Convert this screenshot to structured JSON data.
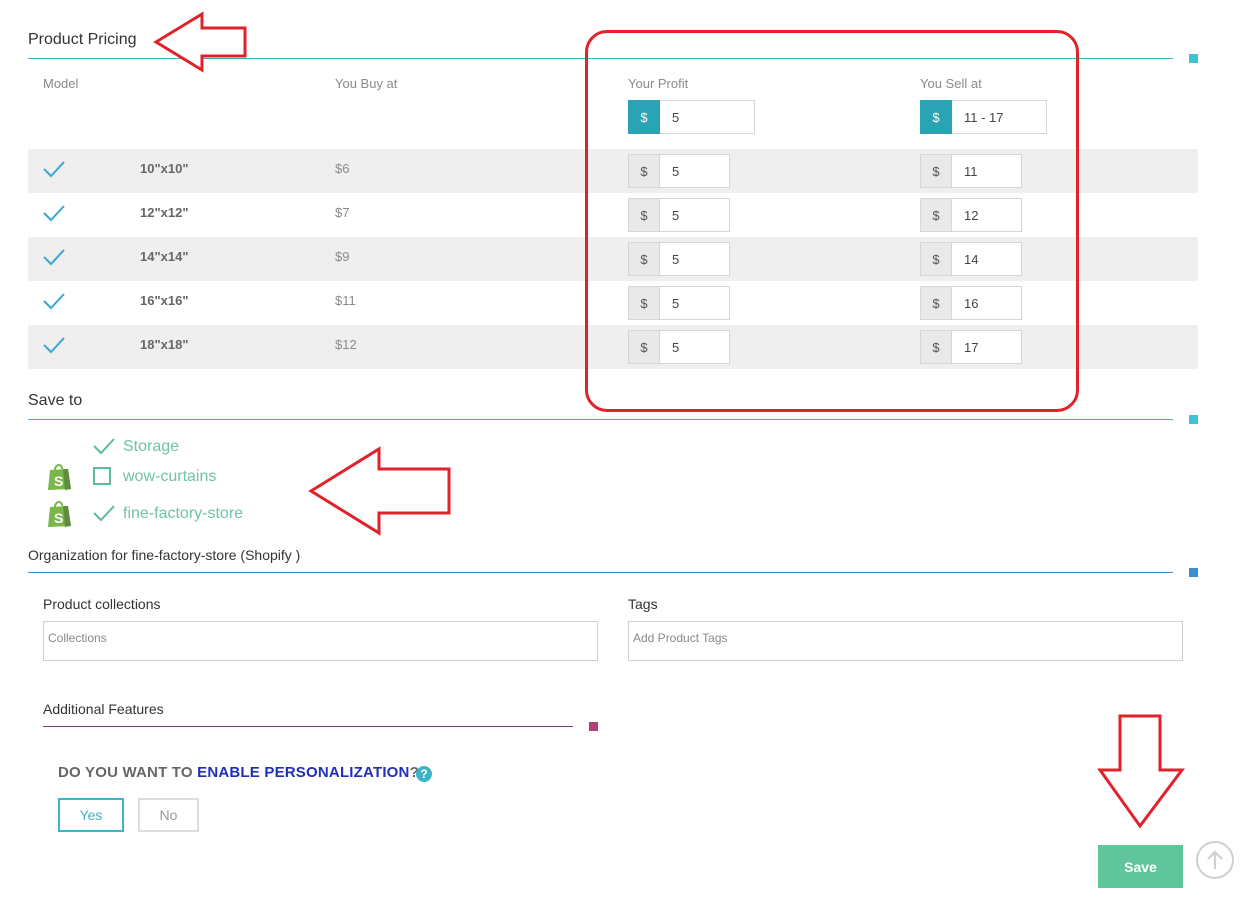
{
  "pricing": {
    "title": "Product Pricing",
    "headers": {
      "model": "Model",
      "buy": "You Buy at",
      "profit": "Your Profit",
      "sell": "You Sell at"
    },
    "master": {
      "currency": "$",
      "profit": "5",
      "sell": "11 - 17"
    },
    "rows": [
      {
        "model": "10\"x10\"",
        "buy": "$6",
        "currency": "$",
        "profit": "5",
        "sell": "11"
      },
      {
        "model": "12\"x12\"",
        "buy": "$7",
        "currency": "$",
        "profit": "5",
        "sell": "12"
      },
      {
        "model": "14\"x14\"",
        "buy": "$9",
        "currency": "$",
        "profit": "5",
        "sell": "14"
      },
      {
        "model": "16\"x16\"",
        "buy": "$11",
        "currency": "$",
        "profit": "5",
        "sell": "16"
      },
      {
        "model": "18\"x18\"",
        "buy": "$12",
        "currency": "$",
        "profit": "5",
        "sell": "17"
      }
    ]
  },
  "save_to": {
    "title": "Save to",
    "stores": [
      {
        "name": "Storage",
        "checked": true,
        "shopify": false
      },
      {
        "name": "wow-curtains",
        "checked": false,
        "shopify": true
      },
      {
        "name": "fine-factory-store",
        "checked": true,
        "shopify": true
      }
    ]
  },
  "organization": {
    "title": "Organization for fine-factory-store (Shopify )",
    "collections_label": "Product collections",
    "collections_placeholder": "Collections",
    "tags_label": "Tags",
    "tags_placeholder": "Add Product Tags"
  },
  "additional": {
    "title": "Additional Features",
    "question_prefix": "DO YOU WANT TO ",
    "question_highlight": "ENABLE PERSONALIZATION",
    "question_suffix": "?",
    "help_icon": "?",
    "yes_label": "Yes",
    "no_label": "No"
  },
  "save_label": "Save",
  "icons": {
    "check": "check-icon",
    "shopify": "shopify-bag-icon",
    "help": "question-circle-icon",
    "scroll_up": "arrow-up-circle-icon",
    "annotation": "red-arrow-icon"
  },
  "colors": {
    "accent": "#2aa4b4",
    "teal_line": "#3fb3c3",
    "green": "#5fc59d",
    "highlight_blue": "#1f2fb8",
    "annotation_red": "#e0222b"
  }
}
